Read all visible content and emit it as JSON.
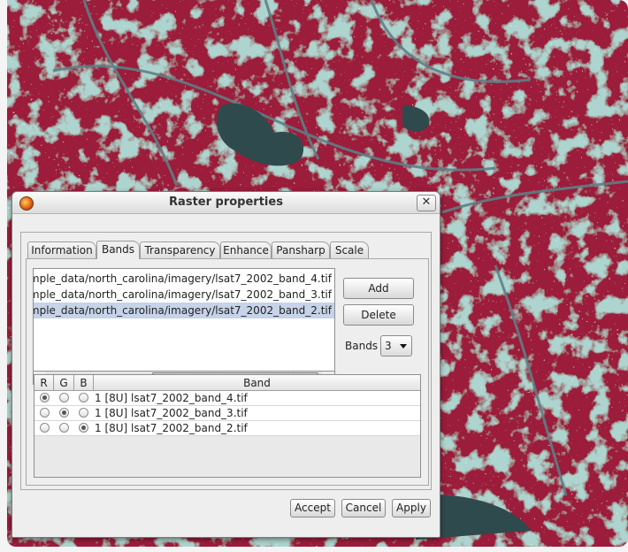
{
  "dialog": {
    "title": "Raster properties",
    "close_glyph": "✕"
  },
  "tabs": [
    {
      "label": "Information"
    },
    {
      "label": "Bands"
    },
    {
      "label": "Transparency"
    },
    {
      "label": "Enhance"
    },
    {
      "label": "Pansharp"
    },
    {
      "label": "Scale"
    }
  ],
  "active_tab": "Bands",
  "files": [
    "mple_data/north_carolina/imagery/lsat7_2002_band_4.tif",
    "mple_data/north_carolina/imagery/lsat7_2002_band_3.tif",
    "mple_data/north_carolina/imagery/lsat7_2002_band_2.tif"
  ],
  "selected_file_index": 2,
  "buttons": {
    "add": "Add",
    "delete": "Delete",
    "accept": "Accept",
    "cancel": "Cancel",
    "apply": "Apply"
  },
  "bands_control": {
    "label": "Bands",
    "value": "3"
  },
  "band_table": {
    "headers": [
      "R",
      "G",
      "B",
      "Band"
    ],
    "rows": [
      {
        "band": "1 [8U] lsat7_2002_band_4.tif",
        "selected_channel": "R"
      },
      {
        "band": "1 [8U] lsat7_2002_band_3.tif",
        "selected_channel": "G"
      },
      {
        "band": "1 [8U] lsat7_2002_band_2.tif",
        "selected_channel": "B"
      }
    ]
  },
  "colors": {
    "map_vegetation": "#9b1f3a",
    "map_urban": "#6aa39a",
    "map_water": "#2f4a4c",
    "selection": "#c6d3e8"
  }
}
